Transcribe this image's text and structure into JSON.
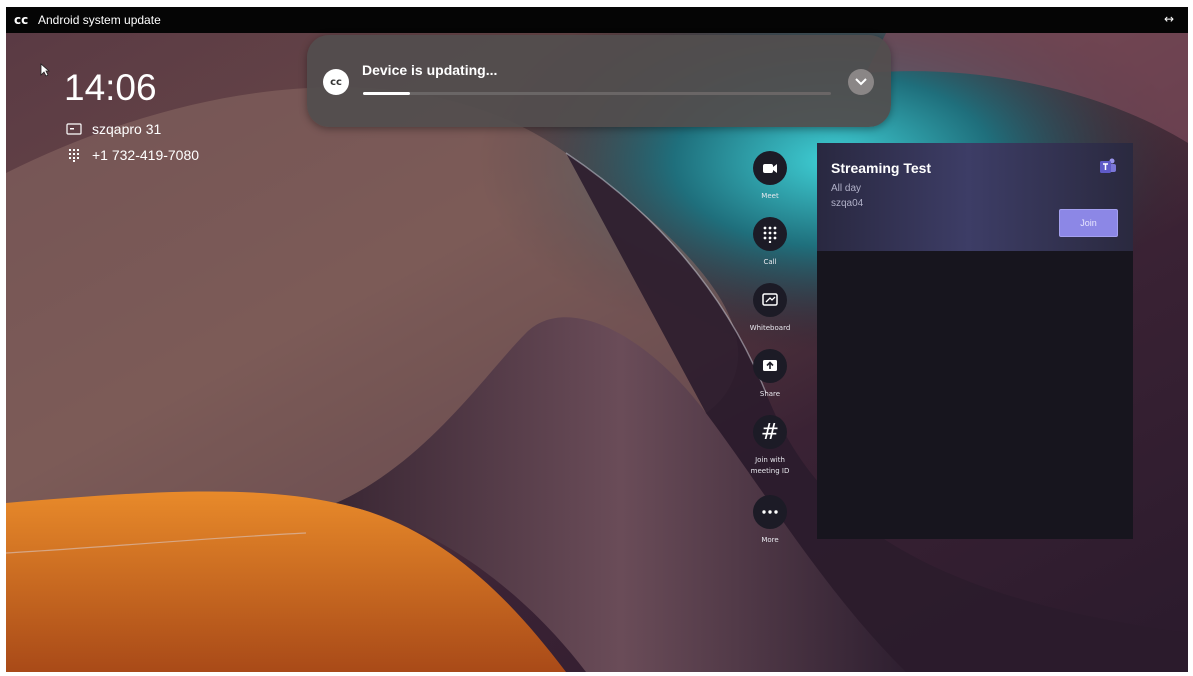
{
  "titlebar": {
    "logo_text": "cc",
    "title": "Android system update",
    "resize_icon": "↔"
  },
  "status": {
    "time": "14:06",
    "room_name": "szqapro 31",
    "phone": "+1 732-419-7080"
  },
  "update": {
    "app_logo": "cc",
    "message": "Device is updating...",
    "progress_fraction": 0.1
  },
  "rail": [
    {
      "name": "meet",
      "label": "Meet",
      "icon": "video-camera-icon"
    },
    {
      "name": "call",
      "label": "Call",
      "icon": "dialpad-icon"
    },
    {
      "name": "whiteboard",
      "label": "Whiteboard",
      "icon": "whiteboard-icon"
    },
    {
      "name": "share",
      "label": "Share",
      "icon": "share-screen-icon"
    },
    {
      "name": "join-id",
      "label": "Join with\nmeeting ID",
      "icon": "hash-icon"
    },
    {
      "name": "more",
      "label": "More",
      "icon": "more-dots-icon"
    }
  ],
  "meeting": {
    "title": "Streaming Test",
    "time": "All day",
    "organizer": "szqa04",
    "join_label": "Join"
  },
  "colors": {
    "accent": "#8c87e6",
    "popup_bg": "#524e4e",
    "titlebar_bg": "#050505"
  }
}
